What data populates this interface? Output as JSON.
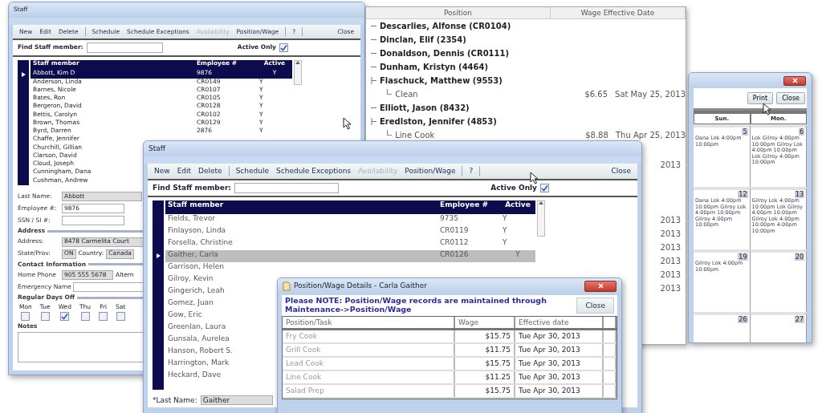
{
  "back_window": {
    "title": "Staff",
    "toolbar": [
      [
        {
          "label": "New",
          "disabled": false
        },
        {
          "label": "Edit",
          "disabled": false
        },
        {
          "label": "Delete",
          "disabled": false
        }
      ],
      [
        {
          "label": "Schedule",
          "disabled": false
        },
        {
          "label": "Schedule Exceptions",
          "disabled": false
        },
        {
          "label": "Availability",
          "disabled": true
        },
        {
          "label": "Position/Wage",
          "disabled": false
        }
      ],
      [
        {
          "label": "?",
          "disabled": false
        }
      ],
      [
        {
          "label": "Close",
          "disabled": false
        }
      ]
    ],
    "find_label": "Find Staff member:",
    "active_only": {
      "label": "Active Only",
      "checked": true
    },
    "columns": [
      "Staff member",
      "Employee #",
      "Active"
    ],
    "rows": [
      {
        "name": "Abbott, Kim D",
        "employee": "9876",
        "active": "Y",
        "selected": true
      },
      {
        "name": "Anderson, Linda",
        "employee": "CR0149",
        "active": "Y",
        "selected": false
      },
      {
        "name": "Barnes, Nicole",
        "employee": "CR0107",
        "active": "Y",
        "selected": false
      },
      {
        "name": "Bates, Ron",
        "employee": "CR0105",
        "active": "Y",
        "selected": false
      },
      {
        "name": "Bergeron, David",
        "employee": "CR0128",
        "active": "Y",
        "selected": false
      },
      {
        "name": "Bettis, Carolyn",
        "employee": "CR0102",
        "active": "Y",
        "selected": false
      },
      {
        "name": "Brown, Thomas",
        "employee": "CR0129",
        "active": "Y",
        "selected": false
      },
      {
        "name": "Byrd, Darren",
        "employee": "2876",
        "active": "Y",
        "selected": false
      },
      {
        "name": "Chaffe, Jennifer",
        "selected": false
      },
      {
        "name": "Churchill, Gillian",
        "selected": false
      },
      {
        "name": "Clarson, David",
        "selected": false
      },
      {
        "name": "Cloud, Joseph",
        "selected": false
      },
      {
        "name": "Cunningham, Dana",
        "selected": false
      },
      {
        "name": "Cushman, Andrew",
        "selected": false
      }
    ],
    "form": {
      "fields": [
        {
          "label": "Last Name:",
          "value": "Abbott"
        },
        {
          "label": "Employee #:",
          "value": "9876"
        },
        {
          "label": "SSN / SI #:"
        }
      ],
      "address_heading": "Address",
      "address": {
        "label": "Address:",
        "value": "8478 Carmelita Court"
      },
      "state": {
        "label": "State/Prov:",
        "value": "ON"
      },
      "country": {
        "label": "Country:",
        "value": "Canada"
      },
      "contact_heading": "Contact Information",
      "home_phone": {
        "label": "Home Phone",
        "value": "905 555 5678"
      },
      "alternate_label": "Altern",
      "emergency": {
        "label": "Emergency Name"
      },
      "days_heading": "Regular Days Off",
      "days": [
        {
          "label": "Mon",
          "checked": false
        },
        {
          "label": "Tue",
          "checked": false
        },
        {
          "label": "Wed",
          "checked": true
        },
        {
          "label": "Thu",
          "checked": false
        },
        {
          "label": "Fri",
          "checked": false
        },
        {
          "label": "Sat",
          "checked": false
        }
      ],
      "notes_label": "Notes"
    }
  },
  "tree_window": {
    "columns": [
      "Position",
      "Wage  Effective Date"
    ],
    "items": [
      {
        "label": "Descarlies, Alfonse  (CR0104)",
        "expanded": false
      },
      {
        "label": "Dinclan, Elif  (2354)",
        "expanded": false
      },
      {
        "label": "Donaldson, Dennis  (CR0111)",
        "expanded": false
      },
      {
        "label": "Dunham, Kristyn  (4464)",
        "expanded": false
      },
      {
        "label": "Flaschuck, Matthew  (9553)",
        "expanded": true,
        "children": [
          {
            "label": "Clean",
            "wage": "$6.65",
            "date": "Sat May 25, 2013"
          }
        ]
      },
      {
        "label": "Elliott, Jason  (8432)",
        "expanded": false
      },
      {
        "label": "Eredlston, Jennifer  (4853)",
        "expanded": true,
        "children": [
          {
            "label": "Line Cook",
            "wage": "$8.88",
            "date": "Thu Apr 25, 2013"
          }
        ]
      }
    ],
    "more_dates": [
      "2013",
      "2013",
      "2013",
      "2013",
      "2013",
      "2013",
      "2013"
    ]
  },
  "calendar_window": {
    "buttons": [
      "Print",
      "Close"
    ],
    "columns": [
      "Sun.",
      "Mon."
    ],
    "weeks": [
      [
        {
          "day": "5",
          "text": "Dana Lok 4:00pm 10:00pm"
        },
        {
          "day": "6",
          "text": "Lok Gilroy 4:00pm 10:00pm Gilroy Lok 4:00pm 10:00pm Lok Gilroy 4:00pm 10:00pm"
        }
      ],
      [
        {
          "day": "12",
          "text": "Dana Lok 4:00pm 10:00pm Gilroy Lok 4:00pm 10:00pm Gilroy 4:00pm 10:00pm"
        },
        {
          "day": "13",
          "text": "Gilroy Lok 4:00pm 10:00pm Lok Gilroy 4:00pm 10:00pm Gilroy Lok 4:00pm 10:00pm 4:00pm 10:00pm"
        }
      ],
      [
        {
          "day": "19",
          "text": "Gilroy Lok 4:00pm 10:00pm"
        },
        {
          "day": "20"
        }
      ],
      [
        {
          "day": "26"
        },
        {
          "day": "27"
        }
      ]
    ]
  },
  "front_window": {
    "title": "Staff",
    "toolbar": [
      [
        {
          "label": "New",
          "disabled": false
        },
        {
          "label": "Edit",
          "disabled": false
        },
        {
          "label": "Delete",
          "disabled": false
        }
      ],
      [
        {
          "label": "Schedule",
          "disabled": false
        },
        {
          "label": "Schedule Exceptions",
          "disabled": false
        },
        {
          "label": "Availability",
          "disabled": true
        },
        {
          "label": "Position/Wage",
          "disabled": false
        }
      ],
      [
        {
          "label": "?",
          "disabled": false
        }
      ],
      [
        {
          "label": "Close",
          "disabled": false
        }
      ]
    ],
    "find_label": "Find Staff member:",
    "active_only": {
      "label": "Active Only",
      "checked": true
    },
    "columns": [
      "Staff member",
      "Employee #",
      "Active"
    ],
    "rows": [
      {
        "name": "Fields, Trevor",
        "employee": "9735",
        "active": "Y",
        "selected": false
      },
      {
        "name": "Finlayson, Linda",
        "employee": "CR0119",
        "active": "Y",
        "selected": false
      },
      {
        "name": "Forsella, Christine",
        "employee": "CR0112",
        "active": "Y",
        "selected": false
      },
      {
        "name": "Gaither, Carla",
        "employee": "CR0126",
        "active": "Y",
        "selected": true
      },
      {
        "name": "Garrison, Helen",
        "selected": false
      },
      {
        "name": "Gilroy, Kevin",
        "selected": false
      },
      {
        "name": "Gingerich, Leah",
        "selected": false
      },
      {
        "name": "Gomez, Juan",
        "selected": false
      },
      {
        "name": "Gow, Eric",
        "selected": false
      },
      {
        "name": "Greenlan, Laura",
        "selected": false
      },
      {
        "name": "Gunsala, Aurelea",
        "selected": false
      },
      {
        "name": "Hanson, Robert S.",
        "selected": false
      },
      {
        "name": "Harrington, Mark",
        "selected": false
      },
      {
        "name": "Heckard, Dave",
        "selected": false
      }
    ],
    "last_name": {
      "label": "*Last Name:",
      "value": "Gaither"
    }
  },
  "wage_dialog": {
    "title": "Position/Wage Details - Carla Gaither",
    "note": "Please NOTE: Position/Wage records are maintained through Maintenance->Position/Wage",
    "close": "Close",
    "columns": [
      "Position/Task",
      "Wage",
      "Effective date"
    ],
    "rows": [
      {
        "position": "Fry Cook",
        "wage": "$15.75",
        "date": "Tue Apr 30, 2013"
      },
      {
        "position": "Grill Cook",
        "wage": "$11.75",
        "date": "Tue Apr 30, 2013"
      },
      {
        "position": "Lead Cook",
        "wage": "$15.75",
        "date": "Tue Apr 30, 2013"
      },
      {
        "position": "Line Cook",
        "wage": "$11.25",
        "date": "Tue Apr 30, 2013"
      },
      {
        "position": "Salad Prep",
        "wage": "$15.75",
        "date": "Tue Apr 30, 2013"
      }
    ]
  }
}
